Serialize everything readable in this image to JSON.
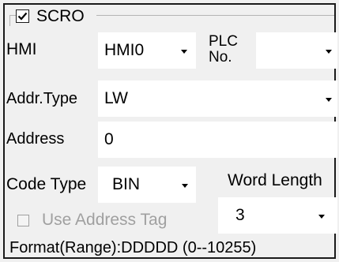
{
  "groupbox": {
    "title": "SCRO",
    "checked": true
  },
  "hmi": {
    "label": "HMI",
    "value": "HMI0"
  },
  "plc": {
    "label_line1": "PLC",
    "label_line2": "No.",
    "value": ""
  },
  "addr_type": {
    "label": "Addr.Type",
    "value": "LW"
  },
  "address": {
    "label": "Address",
    "value": "0"
  },
  "code_type": {
    "label": "Code Type",
    "value": "BIN"
  },
  "word_length": {
    "label": "Word Length",
    "value": "3"
  },
  "use_address_tag": {
    "label": "Use Address Tag",
    "checked": false,
    "enabled": false
  },
  "format": {
    "text": "Format(Range):DDDDD (0--10255)"
  },
  "icons": {
    "dropdown": "chevron-down-icon",
    "check": "checkmark-icon"
  }
}
